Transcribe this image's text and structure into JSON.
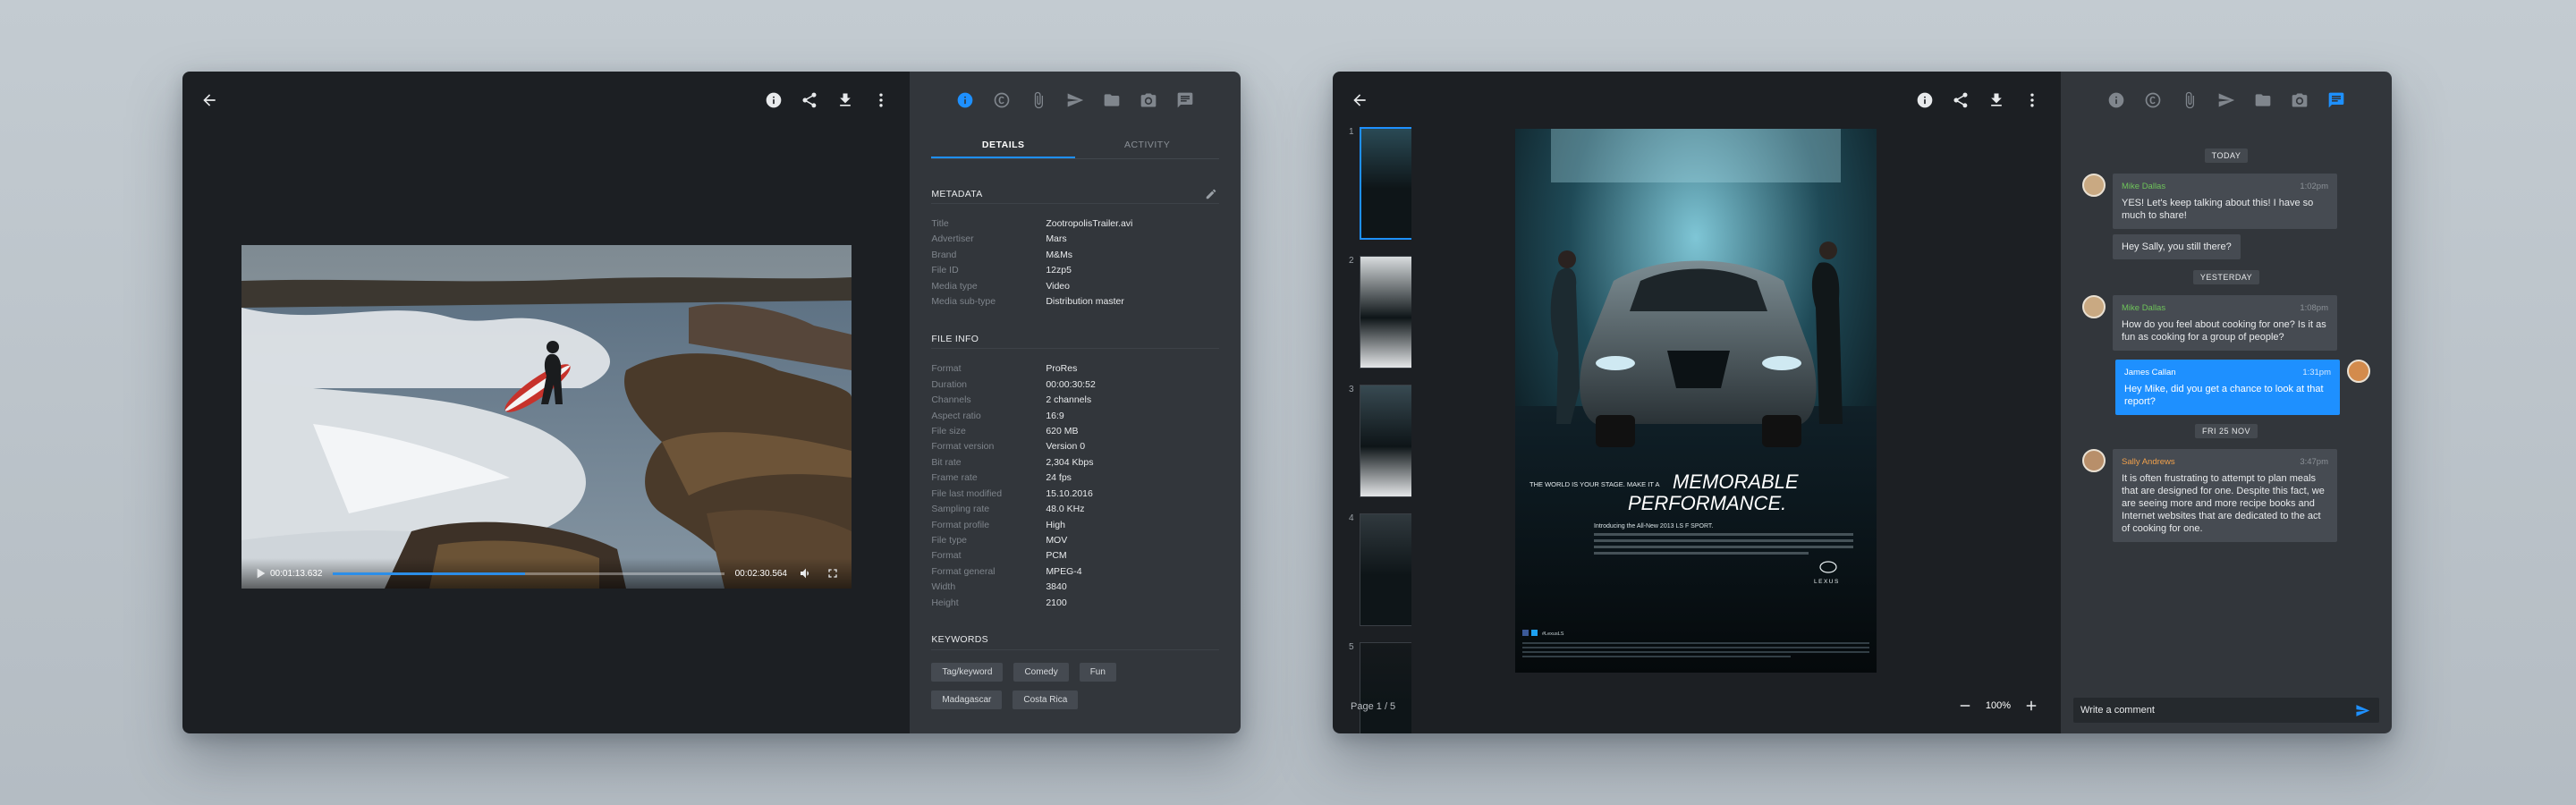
{
  "video_panel": {
    "controls": {
      "current_time": "00:01:13.632",
      "total_time": "00:02:30.564",
      "progress": 0.49
    },
    "sidebar": {
      "tabs": [
        {
          "label": "Details",
          "active": true
        },
        {
          "label": "Activity",
          "active": false
        }
      ],
      "metadata": {
        "title": "Metadata",
        "rows": [
          {
            "k": "Title",
            "v": "ZootropolisTrailer.avi"
          },
          {
            "k": "Advertiser",
            "v": "Mars"
          },
          {
            "k": "Brand",
            "v": "M&Ms"
          },
          {
            "k": "File ID",
            "v": "12zp5"
          },
          {
            "k": "Media type",
            "v": "Video"
          },
          {
            "k": "Media sub-type",
            "v": "Distribution master"
          }
        ]
      },
      "file_info": {
        "title": "File info",
        "rows": [
          {
            "k": "Format",
            "v": "ProRes"
          },
          {
            "k": "Duration",
            "v": "00:00:30:52"
          },
          {
            "k": "Channels",
            "v": "2 channels"
          },
          {
            "k": "Aspect ratio",
            "v": "16:9"
          },
          {
            "k": "File size",
            "v": "620 MB"
          },
          {
            "k": "Format version",
            "v": "Version 0"
          },
          {
            "k": "Bit rate",
            "v": "2,304 Kbps"
          },
          {
            "k": "Frame rate",
            "v": "24 fps"
          },
          {
            "k": "File last modified",
            "v": "15.10.2016"
          },
          {
            "k": "Sampling rate",
            "v": "48.0 KHz"
          },
          {
            "k": "Format profile",
            "v": "High"
          },
          {
            "k": "File type",
            "v": "MOV"
          },
          {
            "k": "Format",
            "v": "PCM"
          },
          {
            "k": "Format general",
            "v": "MPEG-4"
          },
          {
            "k": "Width",
            "v": "3840"
          },
          {
            "k": "Height",
            "v": "2100"
          }
        ]
      },
      "keywords": {
        "title": "Keywords",
        "items": [
          "Tag/keyword",
          "Comedy",
          "Fun",
          "Madagascar",
          "Costa Rica"
        ]
      }
    }
  },
  "doc_panel": {
    "thumbnails": [
      {
        "num": "1"
      },
      {
        "num": "2"
      },
      {
        "num": "3"
      },
      {
        "num": "4"
      },
      {
        "num": "5"
      }
    ],
    "page_label": "Page",
    "page_value": "1 / 5",
    "zoom": "100%",
    "ad": {
      "headline_small": "THE WORLD IS YOUR STAGE. MAKE IT A",
      "headline_1": "MEMORABLE",
      "headline_2": "PERFORMANCE.",
      "body": "Introducing the All-New 2013 LS F SPORT.",
      "brand": "LEXUS",
      "social": "#LexusLS"
    },
    "chat": {
      "groups": [
        {
          "date": "Today",
          "messages": [
            {
              "name": "Mike Dallas",
              "time": "1:02pm",
              "text": "YES! Let's keep talking about this! I have so much to share!",
              "extra": "Hey Sally, you still there?"
            }
          ]
        },
        {
          "date": "Yesterday",
          "messages": [
            {
              "name": "Mike Dallas",
              "time": "1:08pm",
              "text": "How do you feel about cooking for one? Is it as fun as cooking for a group of people?"
            },
            {
              "name": "James Callan",
              "time": "1:31pm",
              "text": "Hey Mike, did you get a chance to look at that report?",
              "mine": true
            }
          ]
        },
        {
          "date": "Fri 25 Nov",
          "messages": [
            {
              "name": "Sally Andrews",
              "time": "3:47pm",
              "text": "It is often frustrating to attempt to plan meals that are designed for one. Despite this fact, we are seeing more and more recipe books and Internet websites that are dedicated to the act of cooking for one."
            }
          ]
        }
      ],
      "compose_placeholder": "Write a comment"
    }
  },
  "colors": {
    "accent": "#1e90ff",
    "sidebar_bg": "#32363b",
    "viewer_bg": "#1c1f23",
    "name_green": "#6ec35a",
    "name_orange": "#f0a04b"
  }
}
